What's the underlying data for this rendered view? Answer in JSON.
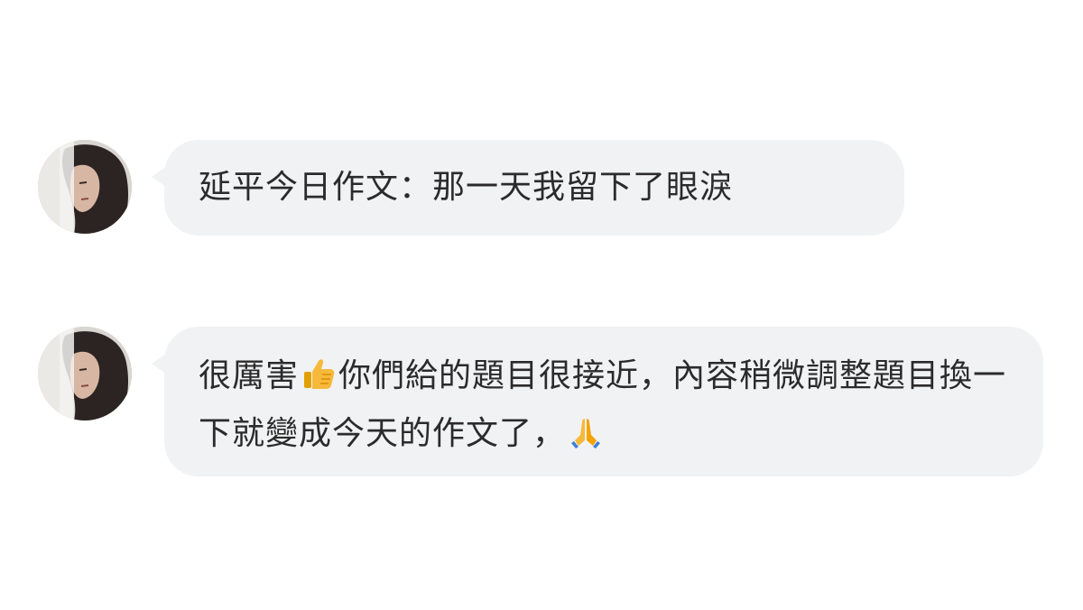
{
  "messages": [
    {
      "avatar": "woman-portrait-avatar",
      "text": "延平今日作文：那一天我留下了眼淚"
    },
    {
      "avatar": "woman-portrait-avatar",
      "part1": "很厲害",
      "emoji1": "thumbs-up-icon",
      "part2": "你們給的題目很接近，內容稍微調整題目換一下就變成今天的作文了，",
      "emoji2": "folded-hands-icon"
    }
  ],
  "colors": {
    "bubble": "#f1f2f4",
    "text": "#2b2b2b",
    "emoji": "#f4b400"
  }
}
